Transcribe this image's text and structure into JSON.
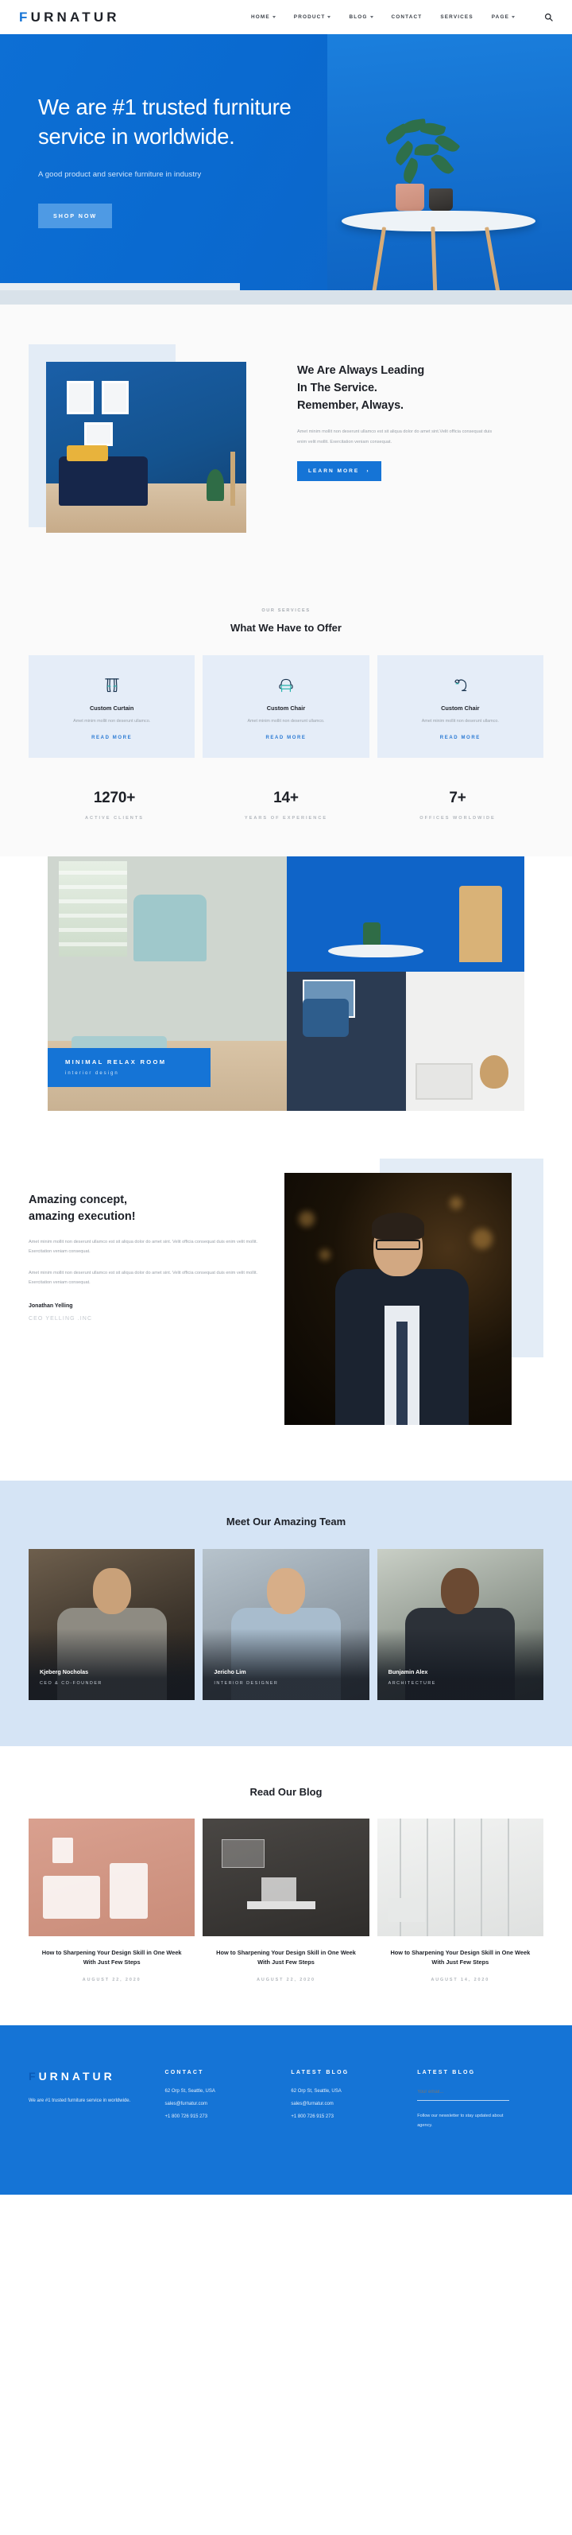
{
  "header": {
    "logo": "FURNATUR",
    "logo_first_letter": "F",
    "logo_rest": "URNATUR",
    "nav": [
      {
        "label": "HOME",
        "has_dropdown": true
      },
      {
        "label": "PRODUCT",
        "has_dropdown": true
      },
      {
        "label": "BLOG",
        "has_dropdown": true
      },
      {
        "label": "CONTACT",
        "has_dropdown": false
      },
      {
        "label": "SERVICES",
        "has_dropdown": false
      },
      {
        "label": "PAGE",
        "has_dropdown": true
      }
    ],
    "search_icon": "search-icon"
  },
  "hero": {
    "headline_line1": "We are #1 trusted furniture",
    "headline_line2": "service in worldwide.",
    "subtext": "A good product and service furniture in industry",
    "cta": "SHOP NOW",
    "background_color": "#0d6fd4"
  },
  "about": {
    "heading_line1": "We Are Always Leading",
    "heading_line2": "In The Service.",
    "heading_line3": "Remember, Always.",
    "body": "Amet minim mollit non deserunt ullamco est sit aliqua  dolor do amet sint.Velit officia consequat duis enim  velit mollit. Exercitation veniam consequat.",
    "cta": "LEARN MORE",
    "cta_color": "#1574d6"
  },
  "services": {
    "eyebrow": "OUR SERVICES",
    "title": "What We Have to Offer",
    "cards": [
      {
        "icon": "curtain-icon",
        "title": "Custom Curtain",
        "body": "Amet minim mollit non deserunt ullamco.",
        "link": "READ MORE"
      },
      {
        "icon": "armchair-icon",
        "title": "Custom Chair",
        "body": "Amet minim mollit non deserunt ullamco.",
        "link": "READ MORE"
      },
      {
        "icon": "lamp-icon",
        "title": "Custom Chair",
        "body": "Amet minim mollit non deserunt ullamco.",
        "link": "READ MORE"
      }
    ],
    "card_background": "#e5edf8",
    "link_color": "#2b7ad4"
  },
  "stats": [
    {
      "number": "1270+",
      "label": "ACTIVE CLIENTS"
    },
    {
      "number": "14+",
      "label": "YEARS OF EXPERIENCE"
    },
    {
      "number": "7+",
      "label": "OFFICES WORLDWIDE"
    }
  ],
  "gallery": {
    "caption_title": "MINIMAL RELAX ROOM",
    "caption_sub": "interior design",
    "caption_bg": "#1574d6"
  },
  "testimonial": {
    "heading_line1": "Amazing concept,",
    "heading_line2": "amazing execution!",
    "paragraph1": "Amet minim mollit non deserunt ullamco est sit aliqua dolor do amet sint. Velit officia consequat duis enim velit mollit. Exercitation veniam consequat.",
    "paragraph2": "Amet minim mollit non deserunt ullamco est sit aliqua dolor do amet sint. Velit officia consequat duis enim velit mollit. Exercitation veniam consequat.",
    "name": "Jonathan Yelling",
    "role": "CEO YELLING .INC"
  },
  "team": {
    "title": "Meet Our Amazing Team",
    "background": "#d5e4f5",
    "members": [
      {
        "name": "Kjeberg Nocholas",
        "role": "CEO & CO-FOUNDER"
      },
      {
        "name": "Jericho Lim",
        "role": "INTERIOR DESIGNER"
      },
      {
        "name": "Bunjamin Alex",
        "role": "ARCHITECTURE"
      }
    ]
  },
  "blog": {
    "title": "Read Our Blog",
    "posts": [
      {
        "title": "How to Sharpening Your Design Skill in One Week With Just Few Steps",
        "date": "AUGUST 22, 2020"
      },
      {
        "title": "How to Sharpening Your Design Skill in One Week With Just Few Steps",
        "date": "AUGUST 22, 2020"
      },
      {
        "title": "How to Sharpening Your Design Skill in One Week With Just Few Steps",
        "date": "AUGUST 14, 2020"
      }
    ]
  },
  "footer": {
    "background": "#1574d6",
    "logo_first_letter": "F",
    "logo_rest": "URNATUR",
    "description": "We are #1 trusted furniture service in worldwide.",
    "contact": {
      "heading": "CONTACT",
      "address": "62 Orp St, Seattle, USA",
      "email": "sales@furnatur.com",
      "phone": "+1 800 726 915 273"
    },
    "latest_blog": {
      "heading": "LATEST BLOG",
      "address": "62 Orp St, Seattle, USA",
      "email": "sales@furnatur.com",
      "phone": "+1 800 726 915 273"
    },
    "newsletter": {
      "heading": "LATEST BLOG",
      "placeholder": "Your email...",
      "note": "Follow our newsletter to stay updated about agency."
    }
  }
}
